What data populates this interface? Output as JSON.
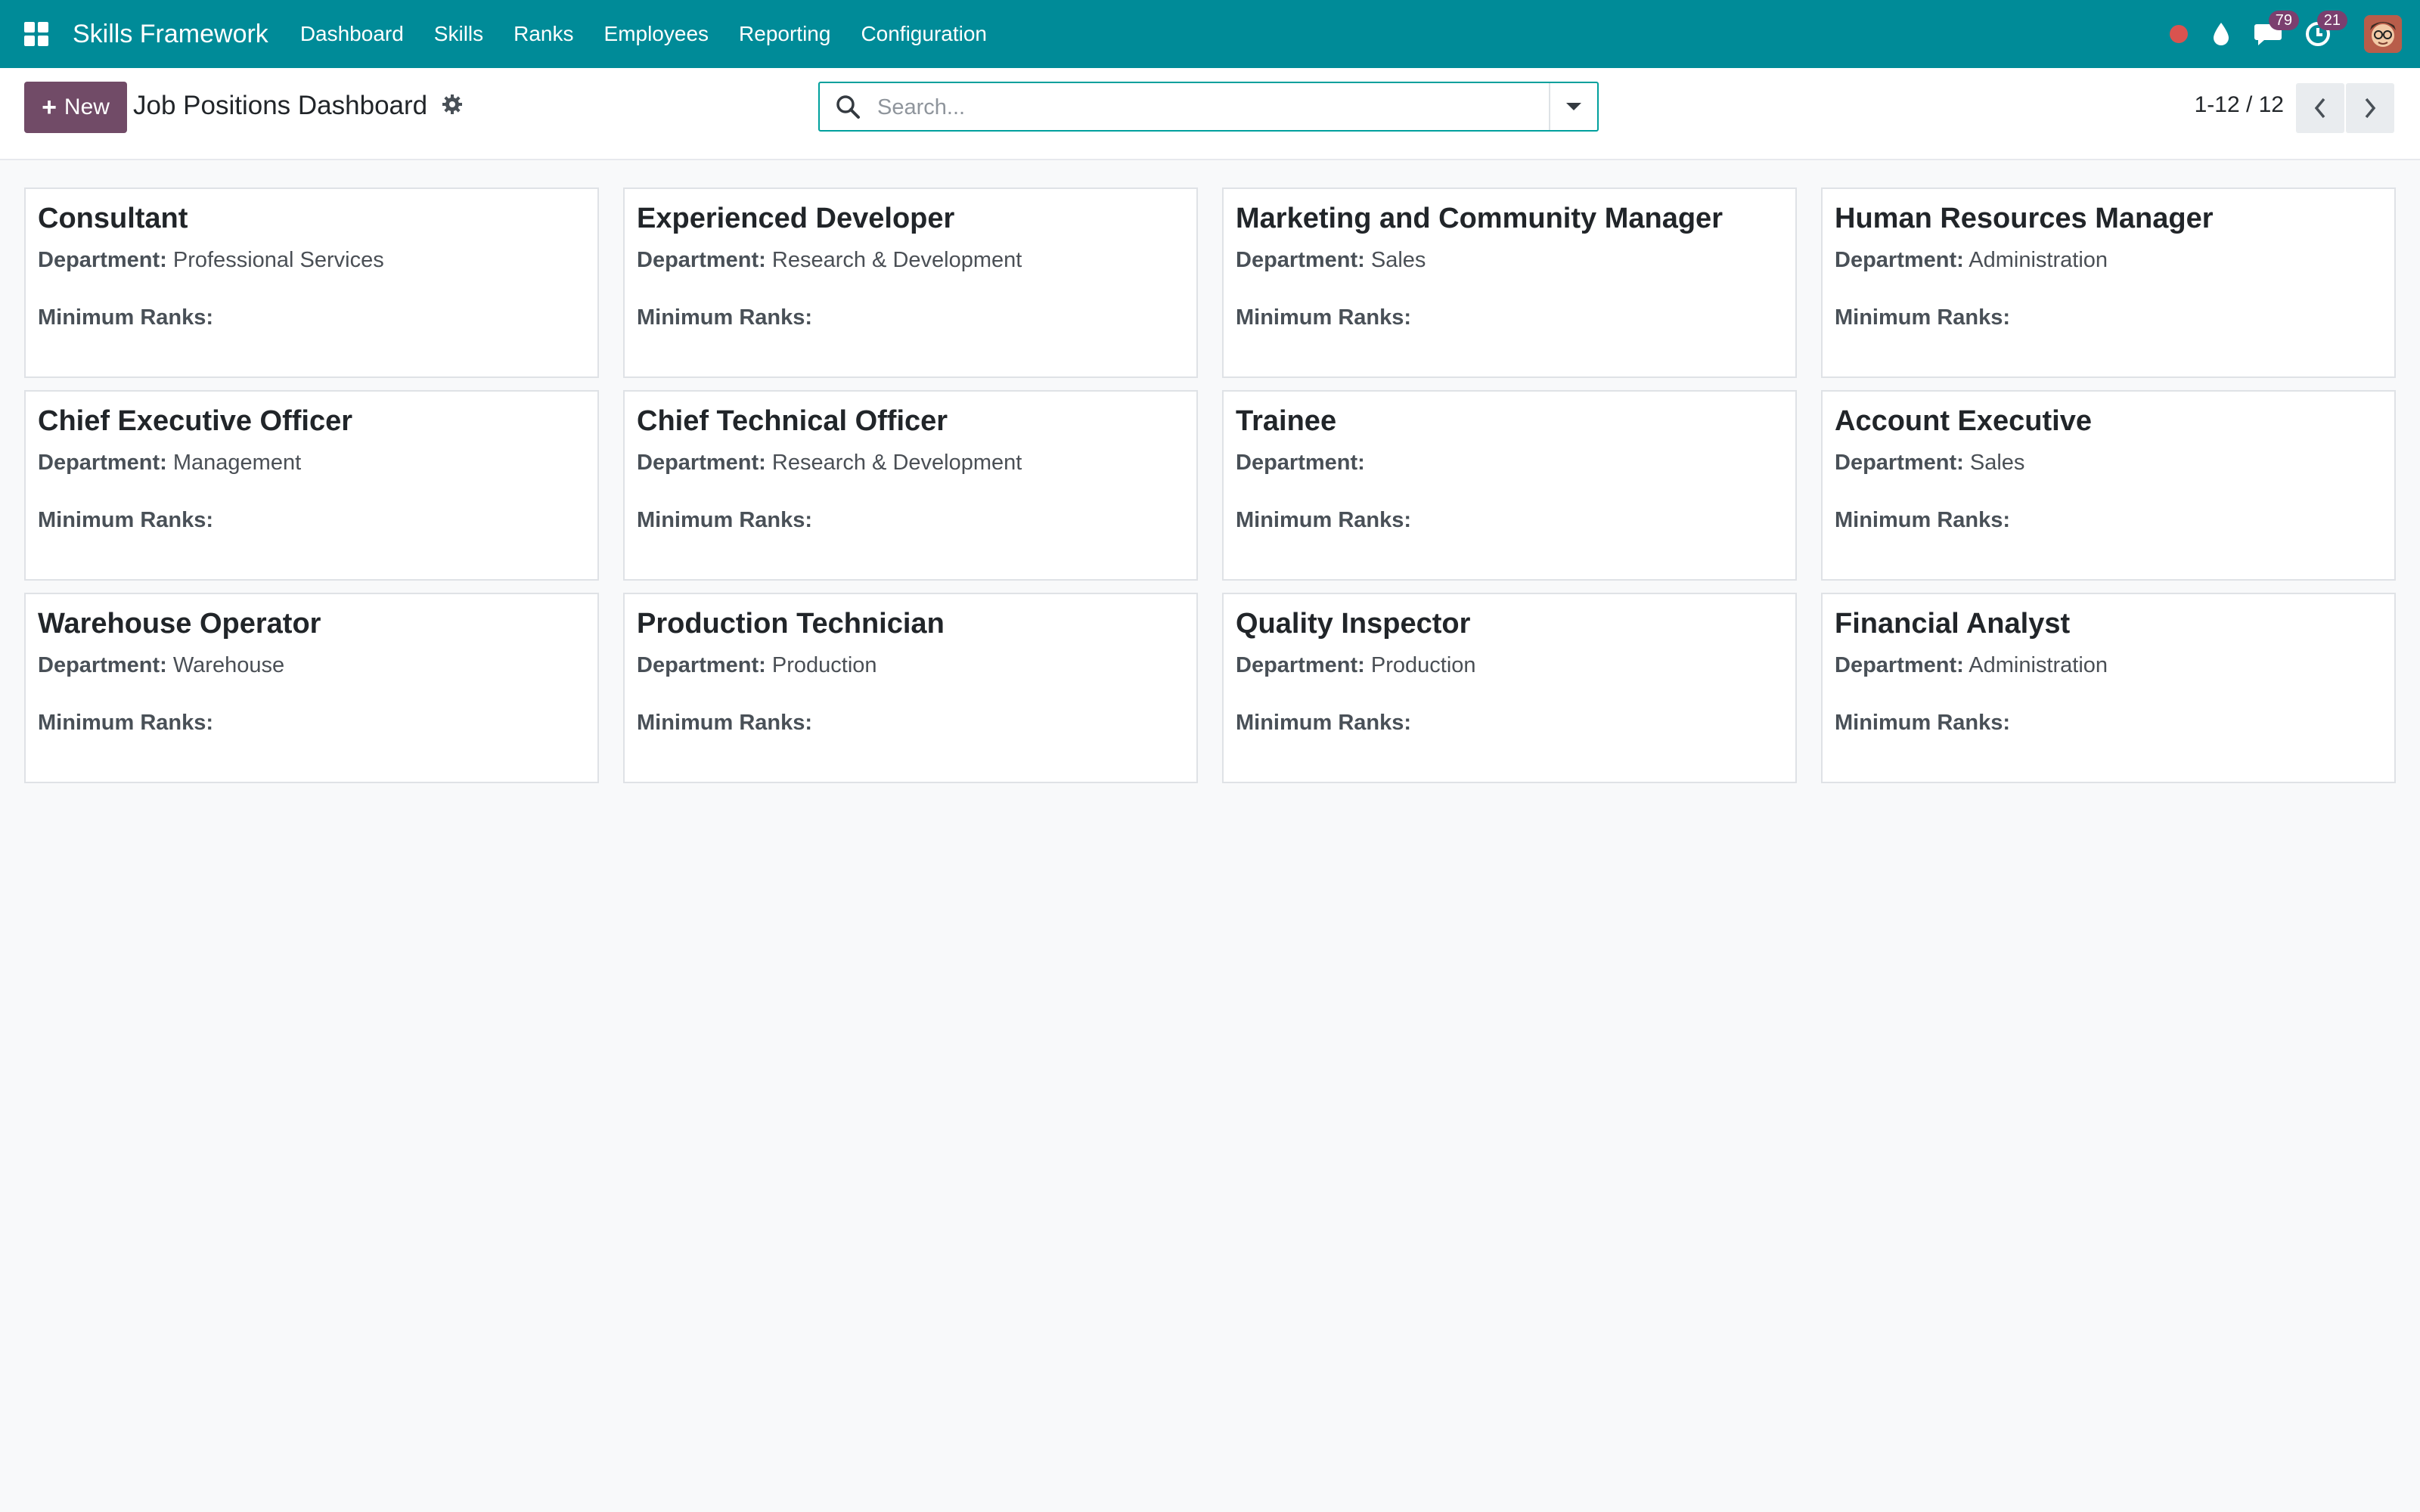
{
  "navbar": {
    "brand": "Skills Framework",
    "menu": [
      "Dashboard",
      "Skills",
      "Ranks",
      "Employees",
      "Reporting",
      "Configuration"
    ],
    "messages_count": "79",
    "activities_count": "21"
  },
  "control_panel": {
    "new_label": "New",
    "title": "Job Positions Dashboard",
    "search_placeholder": "Search...",
    "pager": "1-12 / 12"
  },
  "labels": {
    "department": "Department:",
    "min_ranks": "Minimum Ranks:"
  },
  "cards": [
    {
      "title": "Consultant",
      "department": "Professional Services"
    },
    {
      "title": "Experienced Developer",
      "department": "Research & Development"
    },
    {
      "title": "Marketing and Community Manager",
      "department": "Sales"
    },
    {
      "title": "Human Resources Manager",
      "department": "Administration"
    },
    {
      "title": "Chief Executive Officer",
      "department": "Management"
    },
    {
      "title": "Chief Technical Officer",
      "department": "Research & Development"
    },
    {
      "title": "Trainee",
      "department": ""
    },
    {
      "title": "Account Executive",
      "department": "Sales"
    },
    {
      "title": "Warehouse Operator",
      "department": "Warehouse"
    },
    {
      "title": "Production Technician",
      "department": "Production"
    },
    {
      "title": "Quality Inspector",
      "department": "Production"
    },
    {
      "title": "Financial Analyst",
      "department": "Administration"
    }
  ],
  "colors": {
    "navbar": "#008b98",
    "primary_button": "#714b67",
    "search_border": "#00a09d",
    "badge": "#7b3f6f",
    "record_dot": "#d9534f"
  },
  "icons": [
    "apps-grid-icon",
    "record-dot-icon",
    "drop-icon",
    "chat-icon",
    "clock-icon",
    "settings-gear-icon",
    "search-icon",
    "caret-down-icon",
    "chevron-left-icon",
    "chevron-right-icon"
  ]
}
